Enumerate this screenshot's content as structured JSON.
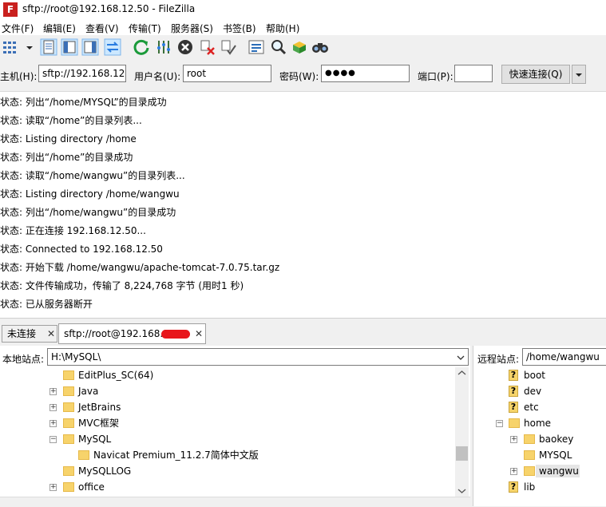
{
  "window": {
    "title": "sftp://root@192.168.12.50 - FileZilla",
    "app_icon_letter": "F"
  },
  "menu": [
    "文件(F)",
    "编辑(E)",
    "查看(V)",
    "传输(T)",
    "服务器(S)",
    "书签(B)",
    "帮助(H)"
  ],
  "quickconnect": {
    "host_label": "主机(H):",
    "host_value": "sftp://192.168.12.50",
    "user_label": "用户名(U):",
    "user_value": "root",
    "pass_label": "密码(W):",
    "pass_value": "●●●●",
    "port_label": "端口(P):",
    "port_value": "",
    "button": "快速连接(Q)"
  },
  "log": [
    "状态: 列出“/home/MYSQL”的目录成功",
    "状态: 读取“/home”的目录列表...",
    "状态: Listing directory /home",
    "状态: 列出“/home”的目录成功",
    "状态: 读取“/home/wangwu”的目录列表...",
    "状态: Listing directory /home/wangwu",
    "状态: 列出“/home/wangwu”的目录成功",
    "状态: 正在连接 192.168.12.50...",
    "状态: Connected to 192.168.12.50",
    "状态: 开始下载 /home/wangwu/apache-tomcat-7.0.75.tar.gz",
    "状态: 文件传输成功，传输了 8,224,768 字节 (用时1 秒)",
    "状态: 已从服务器断开"
  ],
  "tabs": [
    {
      "label": "未连接"
    },
    {
      "label": "sftp://root@192.168.1"
    }
  ],
  "local": {
    "label": "本地站点:",
    "path": "H:\\MySQL\\",
    "tree": [
      {
        "name": "EditPlus_SC(64)",
        "expander": ""
      },
      {
        "name": "Java",
        "expander": "+"
      },
      {
        "name": "JetBrains",
        "expander": "+"
      },
      {
        "name": "MVC框架",
        "expander": "+"
      },
      {
        "name": "MySQL",
        "expander": "−"
      },
      {
        "name": "Navicat Premium_11.2.7简体中文版",
        "expander": ""
      },
      {
        "name": "MySQLLOG",
        "expander": ""
      },
      {
        "name": "office",
        "expander": "+"
      }
    ]
  },
  "remote": {
    "label": "远程站点:",
    "path": "/home/wangwu",
    "tree": [
      {
        "name": "boot",
        "type": "unknown"
      },
      {
        "name": "dev",
        "type": "unknown"
      },
      {
        "name": "etc",
        "type": "unknown"
      },
      {
        "name": "home",
        "type": "folder",
        "expander": "−"
      },
      {
        "name": "baokey",
        "type": "folder",
        "expander": "+"
      },
      {
        "name": "MYSQL",
        "type": "folder",
        "expander": ""
      },
      {
        "name": "wangwu",
        "type": "folder",
        "expander": "+"
      },
      {
        "name": "lib",
        "type": "unknown"
      }
    ]
  },
  "colors": {
    "accent": "#cce8ff",
    "folder": "#f7d36b",
    "redaction": "#e8161b"
  }
}
